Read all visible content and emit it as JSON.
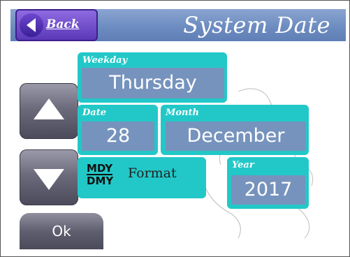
{
  "header": {
    "title": "System Date",
    "back_label": "Back"
  },
  "fields": {
    "weekday": {
      "label": "Weekday",
      "value": "Thursday"
    },
    "date": {
      "label": "Date",
      "value": "28"
    },
    "month": {
      "label": "Month",
      "value": "December"
    },
    "year": {
      "label": "Year",
      "value": "2017"
    }
  },
  "format": {
    "icon_top": "MDY",
    "icon_bottom": "DMY",
    "label": "Format"
  },
  "buttons": {
    "ok_label": "Ok",
    "up_icon": "triangle-up-icon",
    "down_icon": "triangle-down-icon"
  },
  "colors": {
    "accent_teal": "#22c8c8",
    "value_bg": "#7693bd",
    "header_blue": "#6d8cc0",
    "back_purple": "#5b38b8"
  }
}
